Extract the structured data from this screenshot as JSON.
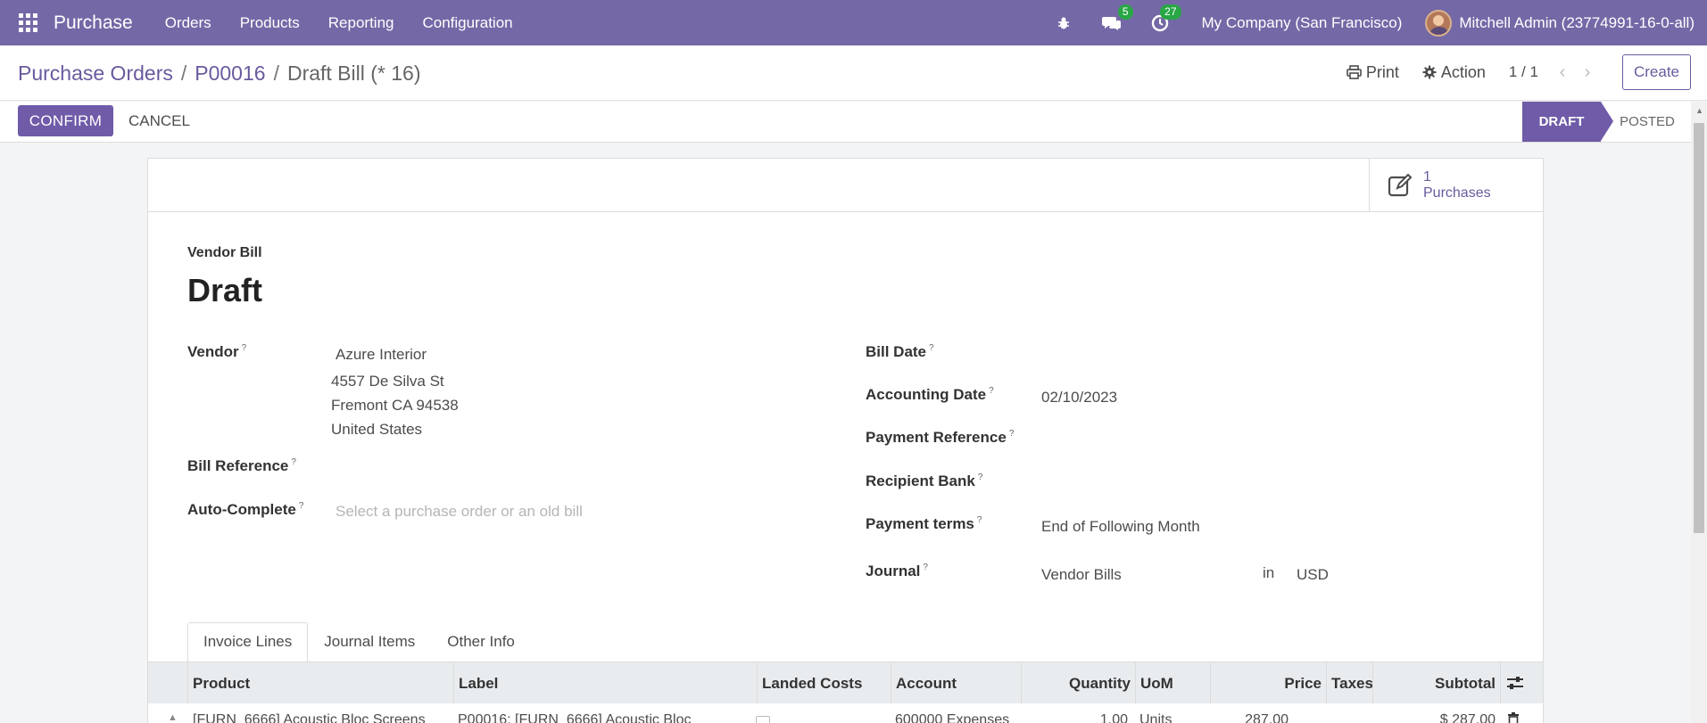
{
  "navbar": {
    "app_name": "Purchase",
    "menu": [
      "Orders",
      "Products",
      "Reporting",
      "Configuration"
    ],
    "messages_count": "5",
    "activities_count": "27",
    "company": "My Company (San Francisco)",
    "user": "Mitchell Admin (23774991-16-0-all)"
  },
  "breadcrumb": {
    "items": [
      "Purchase Orders",
      "P00016",
      "Draft Bill (* 16)"
    ],
    "sep": "/"
  },
  "control": {
    "print_label": "Print",
    "action_label": "Action",
    "pager": "1 / 1",
    "create_label": "Create"
  },
  "statusbar": {
    "confirm_label": "CONFIRM",
    "cancel_label": "CANCEL",
    "stages": [
      "DRAFT",
      "POSTED"
    ],
    "active_stage": "DRAFT"
  },
  "smart_button": {
    "count": "1",
    "label": "Purchases"
  },
  "form": {
    "type_label": "Vendor Bill",
    "title": "Draft",
    "left_fields": {
      "vendor_label": "Vendor",
      "vendor_name": "Azure Interior",
      "vendor_address": [
        "4557 De Silva St",
        "Fremont CA 94538",
        "United States"
      ],
      "bill_reference_label": "Bill Reference",
      "auto_complete_label": "Auto-Complete",
      "auto_complete_placeholder": "Select a purchase order or an old bill"
    },
    "right_fields": {
      "bill_date_label": "Bill Date",
      "accounting_date_label": "Accounting Date",
      "accounting_date_value": "02/10/2023",
      "payment_reference_label": "Payment Reference",
      "recipient_bank_label": "Recipient Bank",
      "payment_terms_label": "Payment terms",
      "payment_terms_value": "End of Following Month",
      "journal_label": "Journal",
      "journal_value": "Vendor Bills",
      "journal_in": "in",
      "currency": "USD"
    },
    "help_mark": "?"
  },
  "tabs": [
    "Invoice Lines",
    "Journal Items",
    "Other Info"
  ],
  "table": {
    "columns": [
      "Product",
      "Label",
      "Landed Costs",
      "Account",
      "Quantity",
      "UoM",
      "Price",
      "Taxes",
      "Subtotal"
    ],
    "rows": [
      {
        "product": "[FURN_6666] Acoustic Bloc Screens",
        "label": "P00016: [FURN_6666] Acoustic Bloc",
        "account": "600000 Expenses",
        "quantity": "1.00",
        "uom": "Units",
        "price": "287.00",
        "taxes": "",
        "subtotal": "$ 287.00"
      }
    ]
  }
}
